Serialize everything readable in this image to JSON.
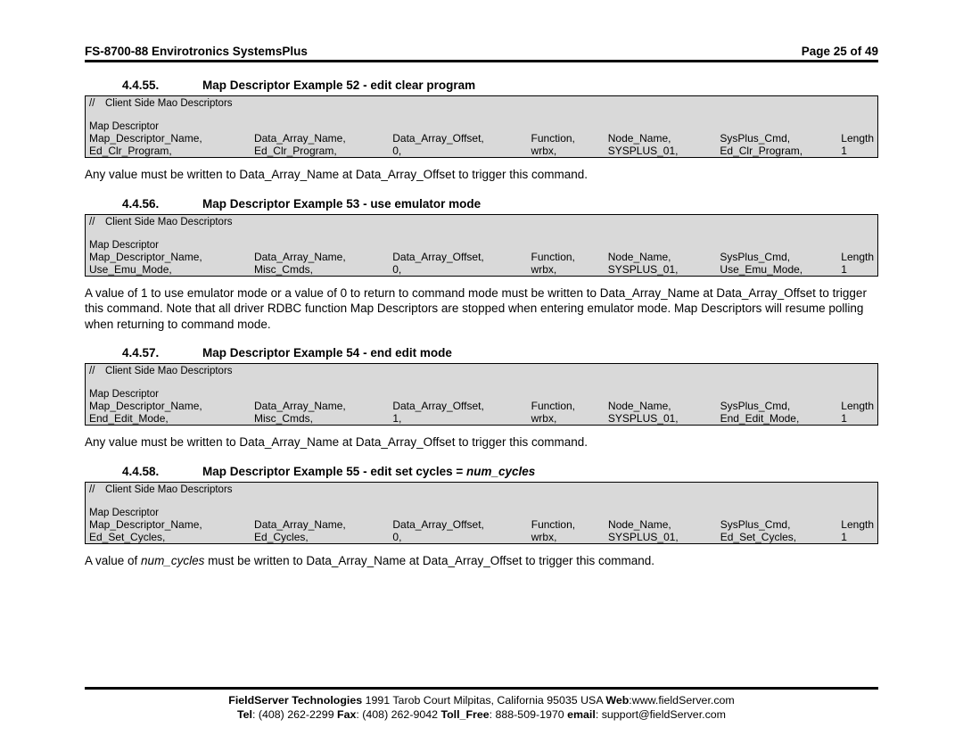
{
  "header": {
    "left": "FS-8700-88 Envirotronics SystemsPlus",
    "right": "Page 25 of 49"
  },
  "sections": [
    {
      "num": "4.4.55.",
      "title": "Map Descriptor Example 52 - edit clear program",
      "italic_tail": "",
      "comment_label": "Client Side Mao Descriptors",
      "subhead": "Map Descriptor",
      "cols": [
        "Map_Descriptor_Name,",
        "Data_Array_Name,",
        "Data_Array_Offset,",
        "Function,",
        "Node_Name,",
        "SysPlus_Cmd,",
        "Length"
      ],
      "row": [
        "Ed_Clr_Program,",
        "Ed_Clr_Program,",
        "0,",
        "wrbx,",
        "SYSPLUS_01,",
        "Ed_Clr_Program,",
        "1"
      ],
      "para_plain": "Any value must be written to Data_Array_Name at Data_Array_Offset to trigger this command.",
      "para_italic": ""
    },
    {
      "num": "4.4.56.",
      "title": "Map Descriptor Example 53 - use emulator mode",
      "italic_tail": "",
      "comment_label": "Client Side Mao Descriptors",
      "subhead": "Map Descriptor",
      "cols": [
        "Map_Descriptor_Name,",
        "Data_Array_Name,",
        "Data_Array_Offset,",
        "Function,",
        "Node_Name,",
        "SysPlus_Cmd,",
        "Length"
      ],
      "row": [
        "Use_Emu_Mode,",
        "Misc_Cmds,",
        "0,",
        "wrbx,",
        "SYSPLUS_01,",
        "Use_Emu_Mode,",
        "1"
      ],
      "para_plain": "A value of 1 to use emulator mode or a value of 0 to return to command mode must be written to Data_Array_Name at Data_Array_Offset to trigger this command. Note that all driver RDBC function Map Descriptors are stopped when entering emulator mode. Map Descriptors will resume polling when returning to command mode.",
      "para_italic": ""
    },
    {
      "num": "4.4.57.",
      "title": "Map Descriptor Example 54 - end edit mode",
      "italic_tail": "",
      "comment_label": "Client Side Mao Descriptors",
      "subhead": "Map Descriptor",
      "cols": [
        "Map_Descriptor_Name,",
        "Data_Array_Name,",
        "Data_Array_Offset,",
        "Function,",
        "Node_Name,",
        "SysPlus_Cmd,",
        "Length"
      ],
      "row": [
        "End_Edit_Mode,",
        "Misc_Cmds,",
        "1,",
        "wrbx,",
        "SYSPLUS_01,",
        "End_Edit_Mode,",
        "1"
      ],
      "para_plain": "Any value must be written to Data_Array_Name at Data_Array_Offset to trigger this command.",
      "para_italic": ""
    },
    {
      "num": "4.4.58.",
      "title": "Map Descriptor Example 55 - edit set cycles = ",
      "italic_tail": "num_cycles",
      "comment_label": "Client Side Mao Descriptors",
      "subhead": "Map Descriptor",
      "cols": [
        "Map_Descriptor_Name,",
        "Data_Array_Name,",
        "Data_Array_Offset,",
        "Function,",
        "Node_Name,",
        "SysPlus_Cmd,",
        "Length"
      ],
      "row": [
        "Ed_Set_Cycles,",
        "Ed_Cycles,",
        "0,",
        "wrbx,",
        "SYSPLUS_01,",
        "Ed_Set_Cycles,",
        "1"
      ],
      "para_plain": " must be written to Data_Array_Name at Data_Array_Offset to trigger this command.",
      "para_italic": "num_cycles",
      "para_prefix": "A value of "
    }
  ],
  "footer": {
    "line1_a": "FieldServer Technologies",
    "line1_b": " 1991 Tarob Court Milpitas, California 95035 USA  ",
    "line1_c": "Web",
    "line1_d": ":www.fieldServer.com",
    "line2_a": "Tel",
    "line2_b": ": (408) 262-2299  ",
    "line2_c": "Fax",
    "line2_d": ": (408) 262-9042  ",
    "line2_e": "Toll_Free",
    "line2_f": ": 888-509-1970  ",
    "line2_g": "email",
    "line2_h": ": support@fieldServer.com"
  },
  "col_widths": [
    "180px",
    "150px",
    "150px",
    "80px",
    "120px",
    "130px",
    "auto"
  ]
}
